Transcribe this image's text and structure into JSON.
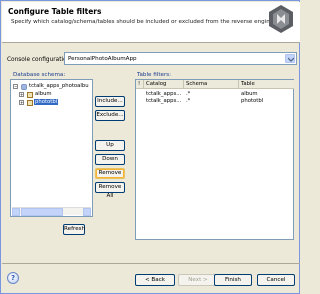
{
  "header": {
    "title": "Configure Table filters",
    "description": "Specify which catalog/schema/tables should be included or excluded from the reverse engineering."
  },
  "console": {
    "label": "Console configuration:",
    "value": "PersonalPhotoAlbumApp"
  },
  "schema": {
    "label": "Database schema:",
    "tree": [
      {
        "label": "tctalk_apps_photoalbu"
      },
      {
        "label": "album"
      },
      {
        "label": "phototbl"
      }
    ],
    "refresh_label": "Refresh"
  },
  "actions": {
    "include": "Include...",
    "exclude": "Exclude...",
    "up": "Up",
    "down": "Down",
    "remove": "Remove",
    "remove_all": "Remove All"
  },
  "filters": {
    "label": "Table filters:",
    "columns": [
      "!",
      "Catalog",
      "Schema",
      "Table"
    ],
    "rows": [
      {
        "exclude": "",
        "catalog": "tctalk_apps...",
        "schema": ".*",
        "table": "album"
      },
      {
        "exclude": "",
        "catalog": "tctalk_apps...",
        "schema": ".*",
        "table": "phototbl"
      }
    ]
  },
  "footer": {
    "help": "?",
    "back": "< Back",
    "next": "Next >",
    "finish": "Finish",
    "cancel": "Cancel"
  }
}
